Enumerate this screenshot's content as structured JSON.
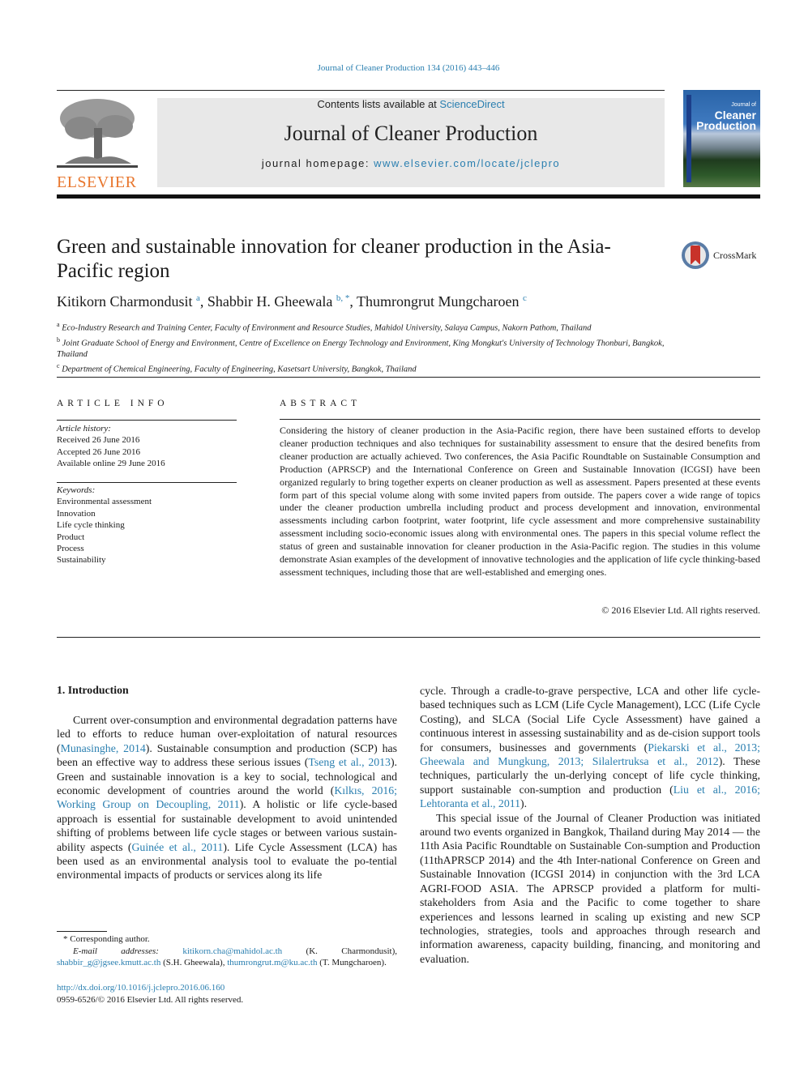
{
  "citation_line": "Journal of Cleaner Production 134 (2016) 443–446",
  "masthead": {
    "contents_prefix": "Contents lists available at ",
    "contents_link": "ScienceDirect",
    "journal_name": "Journal of Cleaner Production",
    "homepage_prefix": "journal homepage: ",
    "homepage_link": "www.elsevier.com/locate/jclepro",
    "publisher_logo_text": "ELSEVIER",
    "cover_small_text": "Journal of",
    "cover_title_line1": "Cleaner",
    "cover_title_line2": "Production"
  },
  "article": {
    "title": "Green and sustainable innovation for cleaner production in the Asia-Pacific region",
    "crossmark_label": "CrossMark",
    "authors": [
      {
        "name": "Kitikorn Charmondusit",
        "sup": "a"
      },
      {
        "name": "Shabbir H. Gheewala",
        "sup": "b, *"
      },
      {
        "name": "Thumrongrut Mungcharoen",
        "sup": "c"
      }
    ],
    "affiliations": [
      {
        "sup": "a",
        "text": "Eco-Industry Research and Training Center, Faculty of Environment and Resource Studies, Mahidol University, Salaya Campus, Nakorn Pathom, Thailand"
      },
      {
        "sup": "b",
        "text": "Joint Graduate School of Energy and Environment, Centre of Excellence on Energy Technology and Environment, King Mongkut's University of Technology Thonburi, Bangkok, Thailand"
      },
      {
        "sup": "c",
        "text": "Department of Chemical Engineering, Faculty of Engineering, Kasetsart University, Bangkok, Thailand"
      }
    ]
  },
  "article_info": {
    "heading": "ARTICLE INFO",
    "history_label": "Article history:",
    "history": [
      "Received 26 June 2016",
      "Accepted 26 June 2016",
      "Available online 29 June 2016"
    ],
    "keywords_label": "Keywords:",
    "keywords": [
      "Environmental assessment",
      "Innovation",
      "Life cycle thinking",
      "Product",
      "Process",
      "Sustainability"
    ]
  },
  "abstract": {
    "heading": "ABSTRACT",
    "text": "Considering the history of cleaner production in the Asia-Pacific region, there have been sustained efforts to develop cleaner production techniques and also techniques for sustainability assessment to ensure that the desired benefits from cleaner production are actually achieved. Two conferences, the Asia Pacific Roundtable on Sustainable Consumption and Production (APRSCP) and the International Conference on Green and Sustainable Innovation (ICGSI) have been organized regularly to bring together experts on cleaner production as well as assessment. Papers presented at these events form part of this special volume along with some invited papers from outside. The papers cover a wide range of topics under the cleaner production umbrella including product and process development and innovation, environmental assessments including carbon footprint, water footprint, life cycle assessment and more comprehensive sustainability assessment including socio-economic issues along with environmental ones. The papers in this special volume reflect the status of green and sustainable innovation for cleaner production in the Asia-Pacific region. The studies in this volume demonstrate Asian examples of the development of innovative technologies and the application of life cycle thinking-based assessment techniques, including those that are well-established and emerging ones.",
    "copyright": "© 2016 Elsevier Ltd. All rights reserved."
  },
  "introduction": {
    "heading": "1.  Introduction",
    "p1": [
      {
        "t": "Current over-consumption and environmental degradation patterns have led to efforts to reduce human over-exploitation of natural resources ("
      },
      {
        "t": "Munasinghe, 2014",
        "link": true
      },
      {
        "t": "). Sustainable consumption and production (SCP) has been an effective way to address these serious issues ("
      },
      {
        "t": "Tseng et al., 2013",
        "link": true
      },
      {
        "t": "). Green and sustainable innovation is a key to social, technological and economic development of countries around the world ("
      },
      {
        "t": "Kılkıs, 2016; Working Group on Decoupling, 2011",
        "link": true
      },
      {
        "t": "). A holistic or life cycle-based approach is essential for sustainable development to avoid unintended shifting of problems between life cycle stages or between various sustain-ability aspects ("
      },
      {
        "t": "Guinée et al., 2011",
        "link": true
      },
      {
        "t": "). Life Cycle Assessment (LCA) has been used as an environmental analysis tool to evaluate the po-tential environmental impacts of products or services along its life"
      }
    ],
    "p1_cont": [
      {
        "t": "cycle. Through a cradle-to-grave perspective, LCA and other life cycle-based techniques such as LCM (Life Cycle Management), LCC (Life Cycle Costing), and SLCA (Social Life Cycle Assessment) have gained a continuous interest in assessing sustainability and as de-cision support tools for consumers, businesses and governments ("
      },
      {
        "t": "Piekarski et al., 2013; Gheewala and Mungkung, 2013; Silalertruksa et al., 2012",
        "link": true
      },
      {
        "t": "). These techniques, particularly the un-derlying concept of life cycle thinking, support sustainable con-sumption and production ("
      },
      {
        "t": "Liu et al., 2016; Lehtoranta et al., 2011",
        "link": true
      },
      {
        "t": ")."
      }
    ],
    "p2": "This special issue of the Journal of Cleaner Production was initiated around two events organized in Bangkok, Thailand during May 2014 — the 11th Asia Pacific Roundtable on Sustainable Con-sumption and Production (11thAPRSCP 2014) and the 4th Inter-national Conference on Green and Sustainable Innovation (ICGSI 2014) in conjunction with the 3rd LCA AGRI-FOOD ASIA. The APRSCP provided a platform for multi-stakeholders from Asia and the Pacific to come together to share experiences and lessons learned in scaling up existing and new SCP technologies, strategies, tools and approaches through research and information awareness, capacity building, financing, and monitoring and evaluation."
  },
  "footnotes": {
    "corresponding": "* Corresponding author.",
    "email_label": "E-mail addresses:",
    "emails": [
      {
        "email": "kitikorn.cha@mahidol.ac.th",
        "who": " (K. Charmondusit), "
      },
      {
        "email": "shabbir_g@jgsee.kmutt.ac.th",
        "who": " (S.H. Gheewala), "
      },
      {
        "email": "thumrongrut.m@ku.ac.th",
        "who": " (T. Mungcharoen)."
      }
    ],
    "doi": "http://dx.doi.org/10.1016/j.jclepro.2016.06.160",
    "issn_line": "0959-6526/© 2016 Elsevier Ltd. All rights reserved."
  }
}
